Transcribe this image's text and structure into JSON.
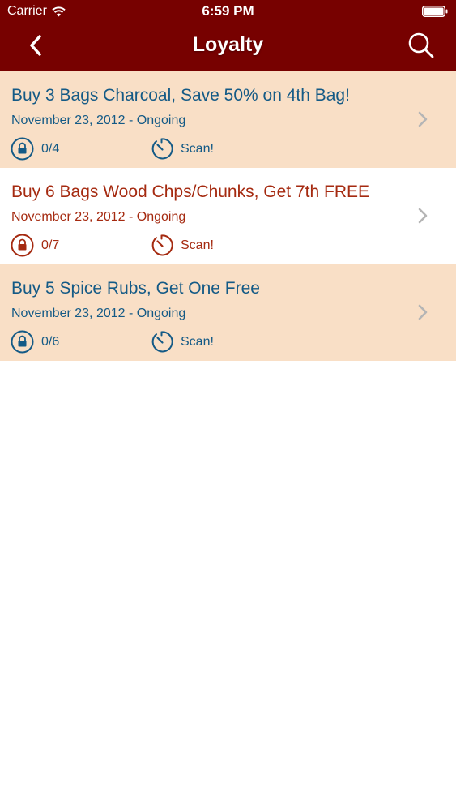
{
  "status_bar": {
    "carrier": "Carrier",
    "time": "6:59 PM"
  },
  "nav": {
    "title": "Loyalty",
    "back_icon": "chevron-left-icon",
    "search_icon": "search-icon"
  },
  "colors": {
    "header": "#770100",
    "row_tinted": "#f9dfc6",
    "blue_text": "#145a86",
    "red_text": "#a52a10"
  },
  "rewards": [
    {
      "title": "Buy 3 Bags Charcoal, Save 50% on 4th Bag!",
      "date": "November 23, 2012 - Ongoing",
      "progress": "0/4",
      "scan": "Scan!"
    },
    {
      "title": "Buy 6 Bags Wood Chps/Chunks, Get 7th FREE",
      "date": "November 23, 2012 - Ongoing",
      "progress": "0/7",
      "scan": "Scan!"
    },
    {
      "title": "Buy 5 Spice Rubs, Get One Free",
      "date": "November 23, 2012 - Ongoing",
      "progress": "0/6",
      "scan": "Scan!"
    }
  ]
}
